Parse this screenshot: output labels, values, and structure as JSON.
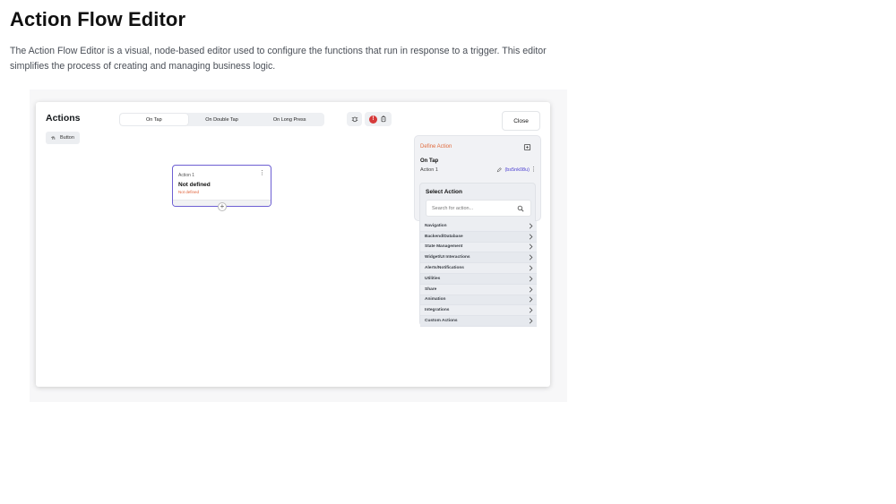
{
  "doc": {
    "title": "Action Flow Editor",
    "description": "The Action Flow Editor is a visual, node-based editor used to configure the functions that run in response to a trigger. This editor simplifies the process of creating and managing business logic."
  },
  "editor": {
    "title": "Actions",
    "widget_chip": "Button",
    "tabs": [
      {
        "label": "On Tap",
        "active": true
      },
      {
        "label": "On Double Tap",
        "active": false
      },
      {
        "label": "On Long Press",
        "active": false
      }
    ],
    "error_count": "!",
    "close_label": "Close",
    "node": {
      "label": "Action 1",
      "title": "Not defined",
      "status": "Not defined",
      "add_symbol": "+"
    },
    "define_panel": {
      "title": "Define Action",
      "trigger": "On Tap",
      "action_label": "Action 1",
      "action_id": "(bs5nk08u)"
    },
    "select_panel": {
      "title": "Select Action",
      "search_placeholder": "Search for action...",
      "categories": [
        "Navigation",
        "Backend/Database",
        "State Management",
        "Widget/UI Interactions",
        "Alerts/Notifications",
        "Utilities",
        "Share",
        "Animation",
        "Integrations",
        "Custom Actions"
      ]
    },
    "colors": {
      "accent": "#6d5fd3",
      "define_title": "#e06b3e",
      "error": "#d63a3a",
      "action_id": "#4b3fd1"
    },
    "icons": [
      "tap-icon",
      "debug-icon",
      "error-icon",
      "history-icon",
      "edit-icon",
      "search-icon",
      "chevron-right-icon",
      "more-vert-icon",
      "add-icon"
    ]
  }
}
